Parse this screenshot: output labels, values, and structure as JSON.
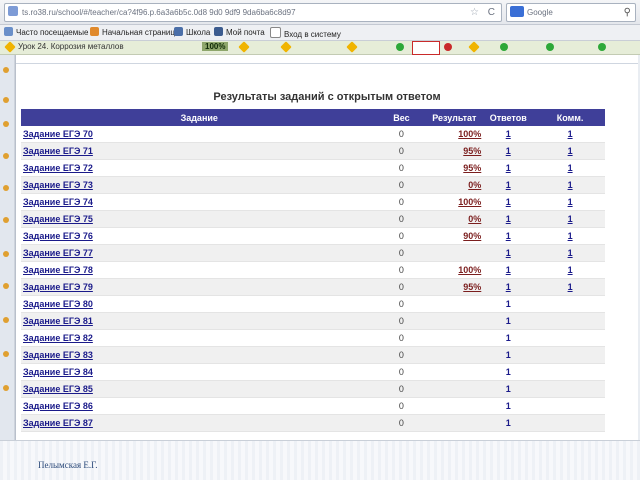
{
  "browser": {
    "url": "ts.ro38.ru/school/#/teacher/ca?4f96.p.6a3a6b5c.0d8 9d0 9df9 9da6ba6c8d97",
    "search_engine_label": "Google"
  },
  "bookmarks": [
    {
      "label": "Часто посещаемые"
    },
    {
      "label": "Начальная страница"
    },
    {
      "label": "Школа"
    },
    {
      "label": "Мой почта"
    },
    {
      "label": "Вход в систему"
    }
  ],
  "lesson_strip": {
    "title": "Урок 24. Коррозия металлов",
    "percent": "100%"
  },
  "page": {
    "heading": "Результаты заданий с открытым ответом"
  },
  "table": {
    "headers": {
      "task": "Задание",
      "weight": "Вес",
      "result": "Результат",
      "answers": "Ответов",
      "comments": "Комм."
    },
    "rows": [
      {
        "task": "Задание ЕГЭ 70",
        "weight": "0",
        "result": "100%",
        "answers": "1",
        "comments": "1"
      },
      {
        "task": "Задание ЕГЭ 71",
        "weight": "0",
        "result": "95%",
        "answers": "1",
        "comments": "1"
      },
      {
        "task": "Задание ЕГЭ 72",
        "weight": "0",
        "result": "95%",
        "answers": "1",
        "comments": "1"
      },
      {
        "task": "Задание ЕГЭ 73",
        "weight": "0",
        "result": "0%",
        "answers": "1",
        "comments": "1"
      },
      {
        "task": "Задание ЕГЭ 74",
        "weight": "0",
        "result": "100%",
        "answers": "1",
        "comments": "1"
      },
      {
        "task": "Задание ЕГЭ 75",
        "weight": "0",
        "result": "0%",
        "answers": "1",
        "comments": "1"
      },
      {
        "task": "Задание ЕГЭ 76",
        "weight": "0",
        "result": "90%",
        "answers": "1",
        "comments": "1"
      },
      {
        "task": "Задание ЕГЭ 77",
        "weight": "0",
        "result": "",
        "answers": "1",
        "comments": "1"
      },
      {
        "task": "Задание ЕГЭ 78",
        "weight": "0",
        "result": "100%",
        "answers": "1",
        "comments": "1"
      },
      {
        "task": "Задание ЕГЭ 79",
        "weight": "0",
        "result": "95%",
        "answers": "1",
        "comments": "1"
      },
      {
        "task": "Задание ЕГЭ 80",
        "weight": "0",
        "result": "",
        "answers": "1",
        "comments": ""
      },
      {
        "task": "Задание ЕГЭ 81",
        "weight": "0",
        "result": "",
        "answers": "1",
        "comments": ""
      },
      {
        "task": "Задание ЕГЭ 82",
        "weight": "0",
        "result": "",
        "answers": "1",
        "comments": ""
      },
      {
        "task": "Задание ЕГЭ 83",
        "weight": "0",
        "result": "",
        "answers": "1",
        "comments": ""
      },
      {
        "task": "Задание ЕГЭ 84",
        "weight": "0",
        "result": "",
        "answers": "1",
        "comments": ""
      },
      {
        "task": "Задание ЕГЭ 85",
        "weight": "0",
        "result": "",
        "answers": "1",
        "comments": ""
      },
      {
        "task": "Задание ЕГЭ 86",
        "weight": "0",
        "result": "",
        "answers": "1",
        "comments": ""
      },
      {
        "task": "Задание ЕГЭ 87",
        "weight": "0",
        "result": "",
        "answers": "1",
        "comments": ""
      }
    ]
  },
  "footer": {
    "author": "Пелымская Е.Г."
  },
  "colors": {
    "table_header": "#3f3f99",
    "link": "#1a1a8a",
    "result_link": "#7b1e1e",
    "ok_icon": "#2da838",
    "error_icon": "#c92a2a"
  }
}
